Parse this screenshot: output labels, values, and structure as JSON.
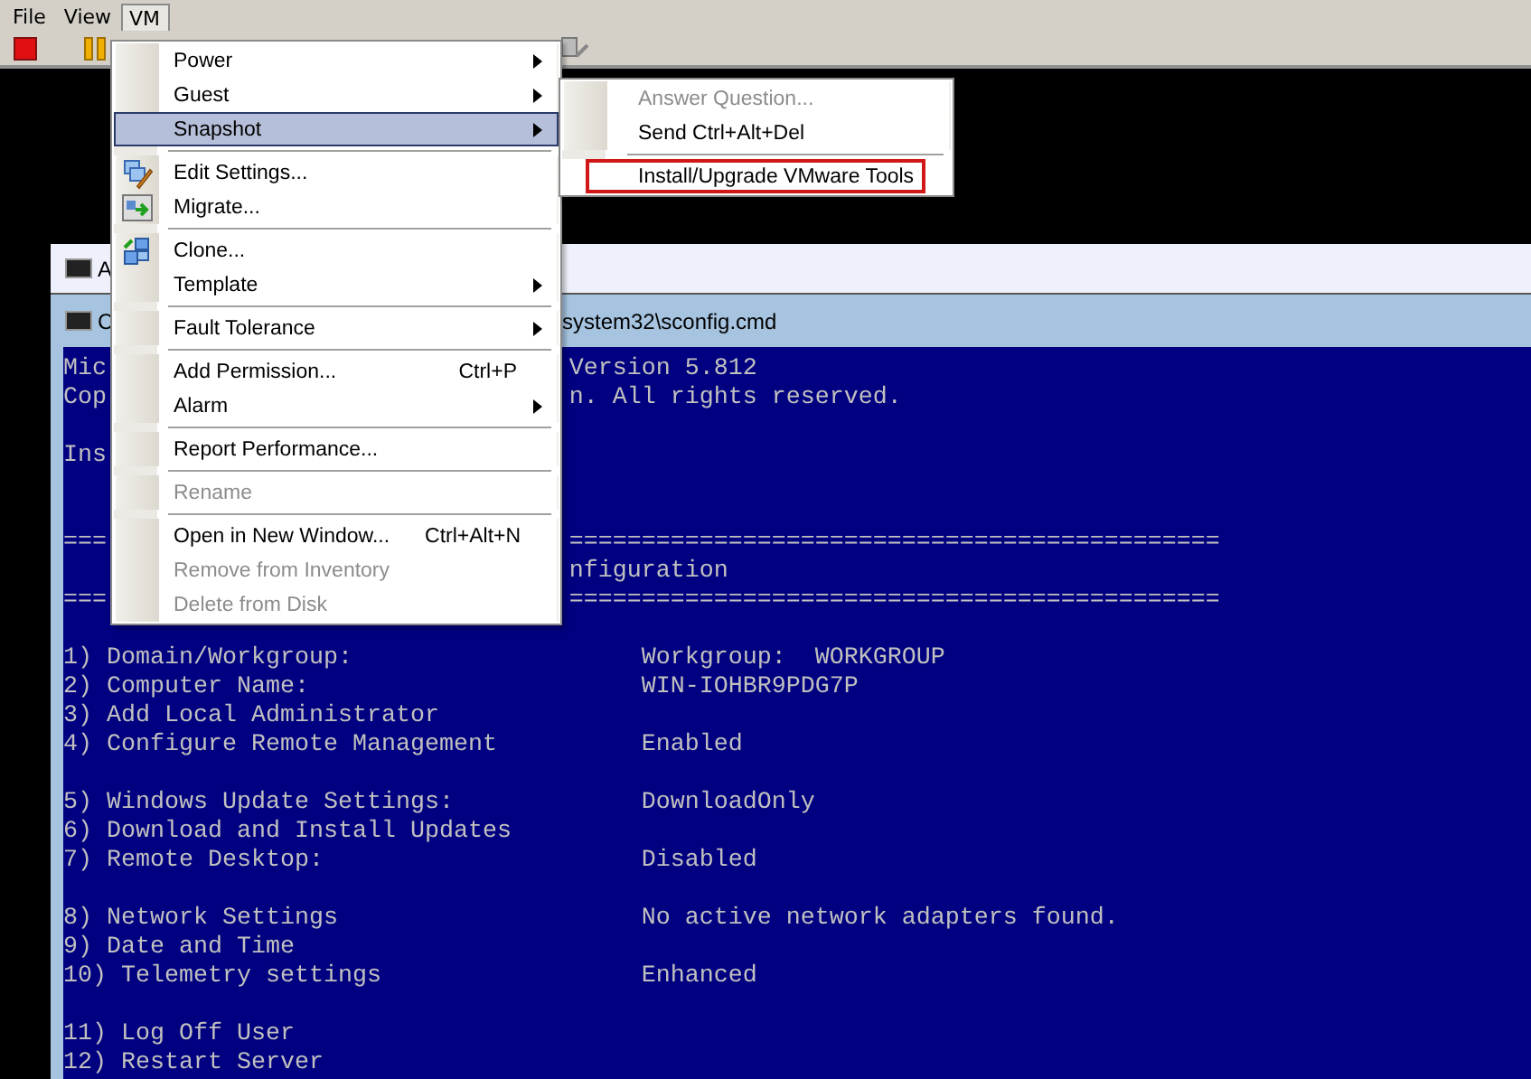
{
  "menubar": [
    {
      "label": "File",
      "selected": false
    },
    {
      "label": "View",
      "selected": false
    },
    {
      "label": "VM",
      "selected": true
    }
  ],
  "console": {
    "back_title": "A",
    "title_start": "C",
    "title_end": "system32\\sconfig.cmd",
    "lines": [
      {
        "kind": "split",
        "left": "Mic",
        "right": "Version 5.812"
      },
      {
        "kind": "split",
        "left": "Cop",
        "right": "n. All rights reserved."
      },
      {
        "kind": "blank"
      },
      {
        "kind": "split",
        "left": "Ins"
      },
      {
        "kind": "blank"
      },
      {
        "kind": "blank"
      },
      {
        "kind": "split",
        "left": "===",
        "right": "============================================="
      },
      {
        "kind": "split",
        "right": "nfiguration"
      },
      {
        "kind": "split",
        "left": "===",
        "right": "============================================="
      },
      {
        "kind": "blank"
      },
      {
        "kind": "item",
        "label": "1) Domain/Workgroup:",
        "value": "Workgroup:  WORKGROUP"
      },
      {
        "kind": "item",
        "label": "2) Computer Name:",
        "value": "WIN-IOHBR9PDG7P"
      },
      {
        "kind": "item",
        "label": "3) Add Local Administrator"
      },
      {
        "kind": "item",
        "label": "4) Configure Remote Management",
        "value": "Enabled"
      },
      {
        "kind": "blank"
      },
      {
        "kind": "item",
        "label": "5) Windows Update Settings:",
        "value": "DownloadOnly"
      },
      {
        "kind": "item",
        "label": "6) Download and Install Updates"
      },
      {
        "kind": "item",
        "label": "7) Remote Desktop:",
        "value": "Disabled"
      },
      {
        "kind": "blank"
      },
      {
        "kind": "item",
        "label": "8) Network Settings",
        "value": "No active network adapters found."
      },
      {
        "kind": "item",
        "label": "9) Date and Time"
      },
      {
        "kind": "item",
        "label": "10) Telemetry settings",
        "value": "Enhanced"
      },
      {
        "kind": "blank"
      },
      {
        "kind": "item",
        "label": "11) Log Off User"
      },
      {
        "kind": "item",
        "label": "12) Restart Server"
      }
    ]
  },
  "menu": {
    "items": [
      {
        "kind": "item",
        "label": "Power",
        "submenu": true,
        "disabled": false,
        "selected": false
      },
      {
        "kind": "item",
        "label": "Guest",
        "submenu": true,
        "disabled": false,
        "selected": false
      },
      {
        "kind": "item",
        "label": "Snapshot",
        "submenu": true,
        "disabled": false,
        "selected": true
      },
      {
        "kind": "separator"
      },
      {
        "kind": "item",
        "label": "Edit Settings...",
        "icon": true,
        "submenu": false,
        "disabled": false,
        "selected": false
      },
      {
        "kind": "item",
        "label": "Migrate...",
        "icon": true,
        "submenu": false,
        "disabled": false,
        "selected": false
      },
      {
        "kind": "separator"
      },
      {
        "kind": "item",
        "label": "Clone...",
        "icon": true,
        "submenu": false,
        "disabled": false,
        "selected": false
      },
      {
        "kind": "item",
        "label": "Template",
        "submenu": true,
        "disabled": false,
        "selected": false
      },
      {
        "kind": "separator"
      },
      {
        "kind": "item",
        "label": "Fault Tolerance",
        "submenu": true,
        "disabled": false,
        "selected": false
      },
      {
        "kind": "separator"
      },
      {
        "kind": "item",
        "label": "Add Permission...",
        "shortcut": "Ctrl+P",
        "submenu": false,
        "disabled": false,
        "selected": false
      },
      {
        "kind": "item",
        "label": "Alarm",
        "submenu": true,
        "disabled": false,
        "selected": false
      },
      {
        "kind": "separator"
      },
      {
        "kind": "item",
        "label": "Report Performance...",
        "submenu": false,
        "disabled": false,
        "selected": false
      },
      {
        "kind": "separator"
      },
      {
        "kind": "item",
        "label": "Rename",
        "submenu": false,
        "disabled": true,
        "selected": false
      },
      {
        "kind": "separator"
      },
      {
        "kind": "item",
        "label": "Open in New Window...",
        "shortcut": "Ctrl+Alt+N",
        "submenu": false,
        "disabled": false,
        "selected": false
      },
      {
        "kind": "item",
        "label": "Remove from Inventory",
        "submenu": false,
        "disabled": true,
        "selected": false
      },
      {
        "kind": "item",
        "label": "Delete from Disk",
        "submenu": false,
        "disabled": true,
        "selected": false
      }
    ]
  },
  "submenu": {
    "items": [
      {
        "kind": "item",
        "label": "Answer Question...",
        "disabled": true,
        "highlighted": false
      },
      {
        "kind": "item",
        "label": "Send Ctrl+Alt+Del",
        "disabled": false,
        "highlighted": false
      },
      {
        "kind": "separator"
      },
      {
        "kind": "item",
        "label": "Install/Upgrade VMware Tools",
        "disabled": false,
        "highlighted": true
      }
    ]
  }
}
